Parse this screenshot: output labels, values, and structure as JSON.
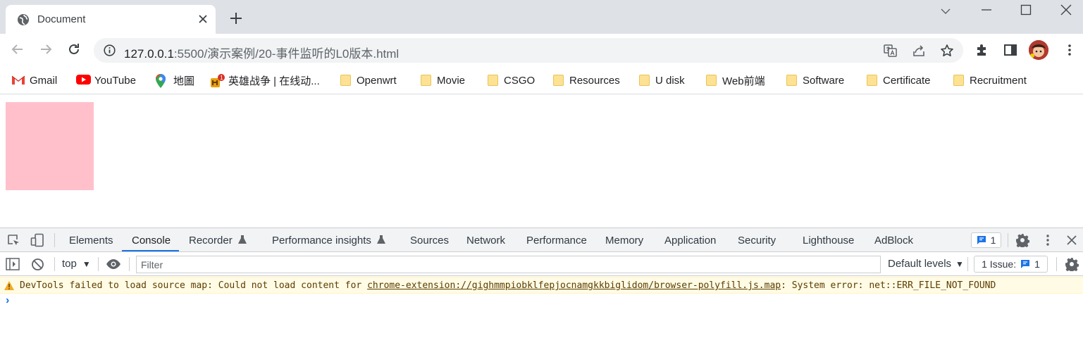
{
  "tab": {
    "title": "Document",
    "new_tab_label": "+"
  },
  "address": {
    "host": "127.0.0.1",
    "path": ":5500/演示案例/20-事件监听的L0版本.html"
  },
  "bookmarks": [
    {
      "label": "Gmail",
      "icon": "gmail-icon"
    },
    {
      "label": "YouTube",
      "icon": "youtube-icon"
    },
    {
      "label": "地圖",
      "icon": "maps-icon"
    },
    {
      "label": "英雄战争 | 在线动...",
      "icon": "game-icon"
    },
    {
      "label": "Openwrt",
      "icon": "folder-icon"
    },
    {
      "label": "Movie",
      "icon": "folder-icon"
    },
    {
      "label": "CSGO",
      "icon": "folder-icon"
    },
    {
      "label": "Resources",
      "icon": "folder-icon"
    },
    {
      "label": "U disk",
      "icon": "folder-icon"
    },
    {
      "label": "Web前端",
      "icon": "folder-icon"
    },
    {
      "label": "Software",
      "icon": "folder-icon"
    },
    {
      "label": "Certificate",
      "icon": "folder-icon"
    },
    {
      "label": "Recruitment",
      "icon": "folder-icon"
    }
  ],
  "page": {
    "box_color": "#ffc0cb"
  },
  "devtools": {
    "tabs": [
      "Elements",
      "Console",
      "Recorder",
      "Performance insights",
      "Sources",
      "Network",
      "Performance",
      "Memory",
      "Application",
      "Security",
      "Lighthouse",
      "AdBlock"
    ],
    "active_tab": "Console",
    "issues_count": "1",
    "console": {
      "context": "top",
      "filter_placeholder": "Filter",
      "levels": "Default levels",
      "issues_label": "1 Issue:",
      "issues_count": "1"
    },
    "warning": {
      "prefix": "DevTools failed to load source map: Could not load content for ",
      "link": "chrome-extension://gighmmpiobklfepjocnamgkkbiglidom/browser-polyfill.js.map",
      "suffix": ": System error: net::ERR_FILE_NOT_FOUND"
    },
    "prompt": "›"
  }
}
